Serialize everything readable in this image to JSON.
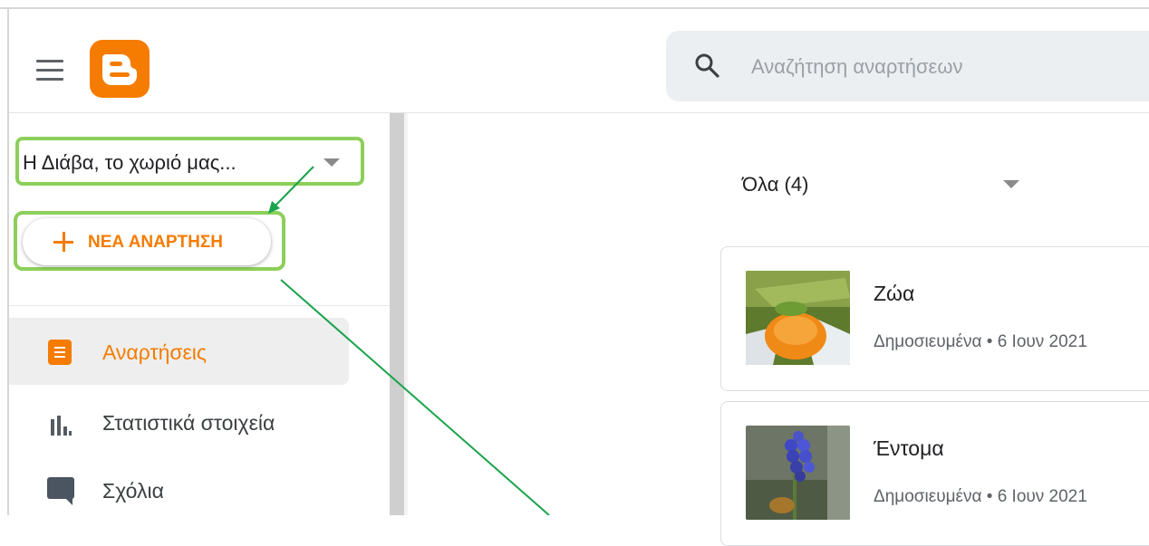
{
  "search": {
    "placeholder": "Αναζήτηση αναρτήσεων"
  },
  "sidebar": {
    "blog_selector": "Η Διάβα, το χωριό μας...",
    "new_post_label": "ΝΕΑ ΑΝΑΡΤΗΣΗ",
    "items": [
      {
        "label": "Αναρτήσεις",
        "icon": "posts-icon",
        "active": true
      },
      {
        "label": "Στατιστικά στοιχεία",
        "icon": "stats-icon",
        "active": false
      },
      {
        "label": "Σχόλια",
        "icon": "comments-icon",
        "active": false
      }
    ]
  },
  "main": {
    "filter_label": "Όλα (4)",
    "posts": [
      {
        "title": "Ζώα",
        "meta": "Δημοσιευμένα • 6 Ιουν 2021"
      },
      {
        "title": "Έντομα",
        "meta": "Δημοσιευμένα • 6 Ιουν 2021"
      }
    ]
  },
  "colors": {
    "brand": "#f57c00",
    "highlight": "#8ccf5a",
    "arrow": "#1aa34a"
  }
}
